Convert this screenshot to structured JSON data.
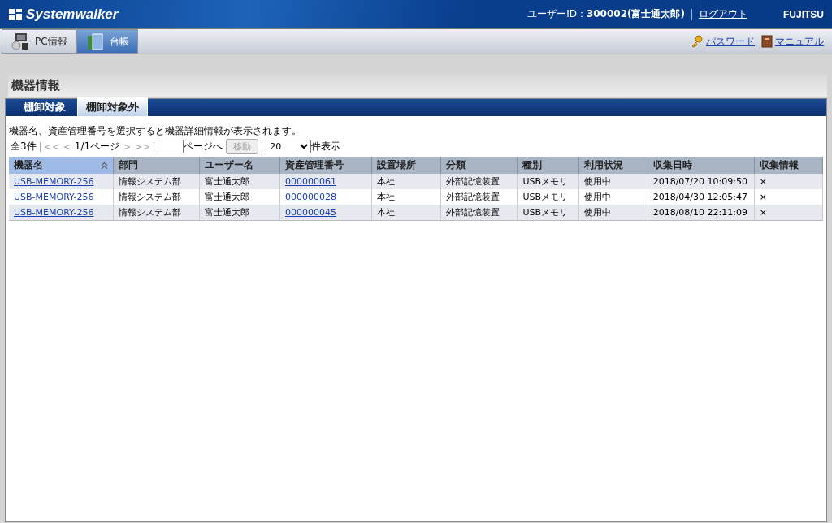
{
  "header": {
    "logo": "Systemwalker",
    "user_label": "ユーザーID：",
    "user_value": "300002(富士通太郎)",
    "logout": "ログアウト",
    "brand": "FUJITSU"
  },
  "nav_tabs": [
    {
      "label": "PC情報",
      "selected": false
    },
    {
      "label": "台帳",
      "selected": true
    }
  ],
  "nav_links": [
    "パスワード",
    "マニュアル"
  ],
  "page_title": "機器情報",
  "tabs": [
    {
      "label": "棚卸対象",
      "selected": false
    },
    {
      "label": "棚卸対象外",
      "selected": true
    }
  ],
  "description": "機器名、資産管理番号を選択すると機器詳細情報が表示されます。",
  "pager": {
    "total": "全3件",
    "first": "<<",
    "prev": "<",
    "page": "1/1ページ",
    "next": ">",
    "last": ">>",
    "disabled": true,
    "goto_suffix": "ページへ",
    "go_button": "移動",
    "per_page": "20",
    "per_page_suffix": "件表示"
  },
  "table": {
    "columns": [
      {
        "label": "機器名",
        "sorted": true,
        "kind": "link"
      },
      {
        "label": "部門",
        "sorted": false
      },
      {
        "label": "ユーザー名",
        "sorted": false
      },
      {
        "label": "資産管理番号",
        "sorted": false,
        "kind": "link"
      },
      {
        "label": "設置場所",
        "sorted": false
      },
      {
        "label": "分類",
        "sorted": false
      },
      {
        "label": "種別",
        "sorted": false
      },
      {
        "label": "利用状況",
        "sorted": false
      },
      {
        "label": "収集日時",
        "sorted": false
      },
      {
        "label": "収集情報",
        "sorted": false
      }
    ],
    "rows": [
      [
        "USB-MEMORY-256",
        "情報システム部",
        "富士通太郎",
        "000000061",
        "本社",
        "外部記憶装置",
        "USBメモリ",
        "使用中",
        "2018/07/20 10:09:50",
        "×"
      ],
      [
        "USB-MEMORY-256",
        "情報システム部",
        "富士通太郎",
        "000000028",
        "本社",
        "外部記憶装置",
        "USBメモリ",
        "使用中",
        "2018/04/30 12:05:47",
        "×"
      ],
      [
        "USB-MEMORY-256",
        "情報システム部",
        "富士通太郎",
        "000000045",
        "本社",
        "外部記憶装置",
        "USBメモリ",
        "使用中",
        "2018/08/10 22:11:09",
        "×"
      ]
    ]
  }
}
